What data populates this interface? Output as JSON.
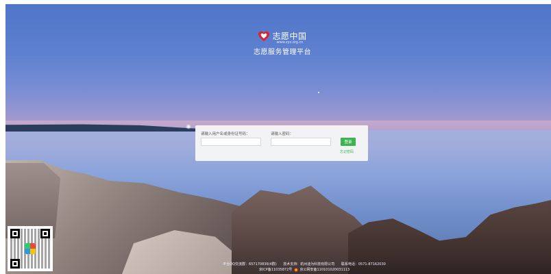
{
  "brand": {
    "name": "志愿中国",
    "url": "www.zyz.org.cn",
    "subtitle": "志愿服务管理平台",
    "heart_color": "#d9232e"
  },
  "login": {
    "username_label": "请输入用户名或身份证号码：",
    "username_value": "",
    "password_label": "请输入密码：",
    "password_value": "",
    "login_button": "登录",
    "forgot_link": "忘记密码",
    "accent_color": "#3cb44f"
  },
  "footer": {
    "qq_group": "平台QQ交流群：657170836(4群)",
    "tech_support": "技术支持：杭州迪为科技有限公司",
    "phone": "联系电话：0571-87162030",
    "icp": "京ICP备11035872号",
    "police": "京公网安备110101020031113"
  },
  "icons": [
    "heart-logo-icon",
    "qr-code",
    "police-badge-icon"
  ]
}
